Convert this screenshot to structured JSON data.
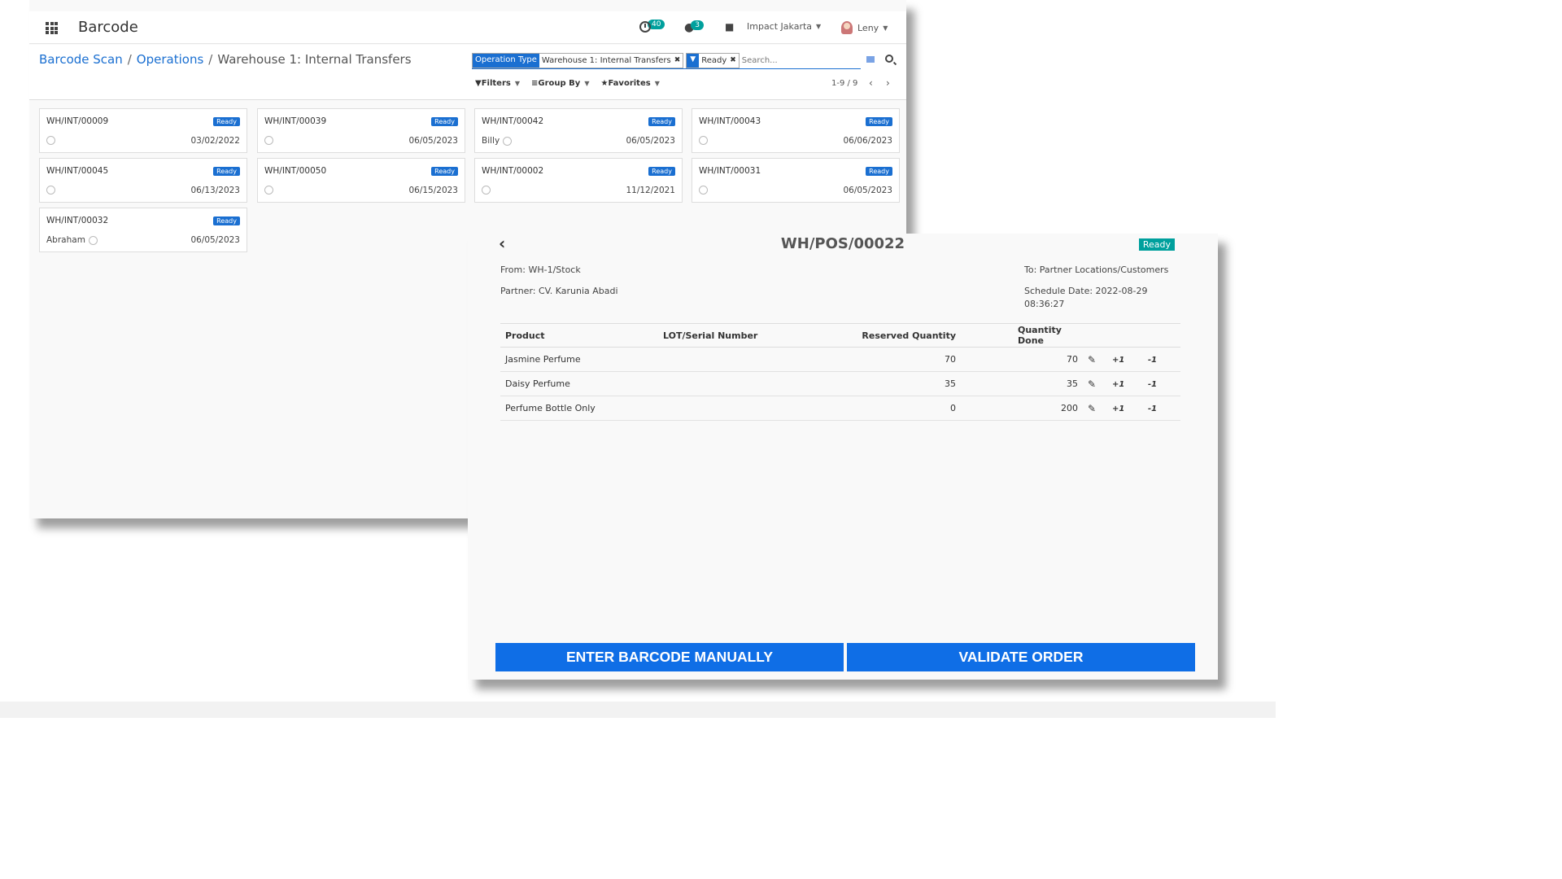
{
  "app": {
    "title": "Barcode",
    "activity_count": "40",
    "message_count": "3",
    "company": "Impact Jakarta",
    "user": "Leny"
  },
  "breadcrumb": {
    "items": [
      "Barcode Scan",
      "Operations"
    ],
    "current": "Warehouse 1: Internal Transfers"
  },
  "search": {
    "facets": [
      {
        "key": "Operation Type",
        "value": "Warehouse 1: Internal Transfers"
      },
      {
        "key": "filter-icon",
        "value": "Ready"
      }
    ],
    "placeholder": "Search...",
    "filters_label": "Filters",
    "groupby_label": "Group By",
    "favorites_label": "Favorites",
    "pager": "1-9 / 9"
  },
  "cards": [
    {
      "name": "WH/INT/00009",
      "status": "Ready",
      "owner": "",
      "date": "03/02/2022"
    },
    {
      "name": "WH/INT/00039",
      "status": "Ready",
      "owner": "",
      "date": "06/05/2023"
    },
    {
      "name": "WH/INT/00042",
      "status": "Ready",
      "owner": "Billy",
      "date": "06/05/2023"
    },
    {
      "name": "WH/INT/00043",
      "status": "Ready",
      "owner": "",
      "date": "06/06/2023"
    },
    {
      "name": "WH/INT/00045",
      "status": "Ready",
      "owner": "",
      "date": "06/13/2023"
    },
    {
      "name": "WH/INT/00050",
      "status": "Ready",
      "owner": "",
      "date": "06/15/2023"
    },
    {
      "name": "WH/INT/00002",
      "status": "Ready",
      "owner": "",
      "date": "11/12/2021"
    },
    {
      "name": "WH/INT/00031",
      "status": "Ready",
      "owner": "",
      "date": "06/05/2023"
    },
    {
      "name": "WH/INT/00032",
      "status": "Ready",
      "owner": "Abraham",
      "date": "06/05/2023"
    }
  ],
  "detail": {
    "title": "WH/POS/00022",
    "status": "Ready",
    "from": "From: WH-1/Stock",
    "partner": "Partner: CV. Karunia Abadi",
    "to": "To: Partner Locations/Customers",
    "schedule": "Schedule Date: 2022-08-29",
    "schedule_time": "08:36:27",
    "columns": [
      "Product",
      "LOT/Serial Number",
      "Reserved Quantity",
      "Quantity Done"
    ],
    "lines": [
      {
        "product": "Jasmine Perfume",
        "lot": "",
        "reserved": "70",
        "done": "70",
        "plus": "+1",
        "minus": "-1"
      },
      {
        "product": "Daisy Perfume",
        "lot": "",
        "reserved": "35",
        "done": "35",
        "plus": "+1",
        "minus": "-1"
      },
      {
        "product": "Perfume Bottle Only",
        "lot": "",
        "reserved": "0",
        "done": "200",
        "plus": "+1",
        "minus": "-1"
      }
    ],
    "enter_barcode_label": "ENTER BARCODE MANUALLY",
    "validate_label": "VALIDATE ORDER"
  },
  "colors": {
    "primary": "#1a6fd1",
    "teal": "#00a09d",
    "button": "#0f6ee6"
  }
}
